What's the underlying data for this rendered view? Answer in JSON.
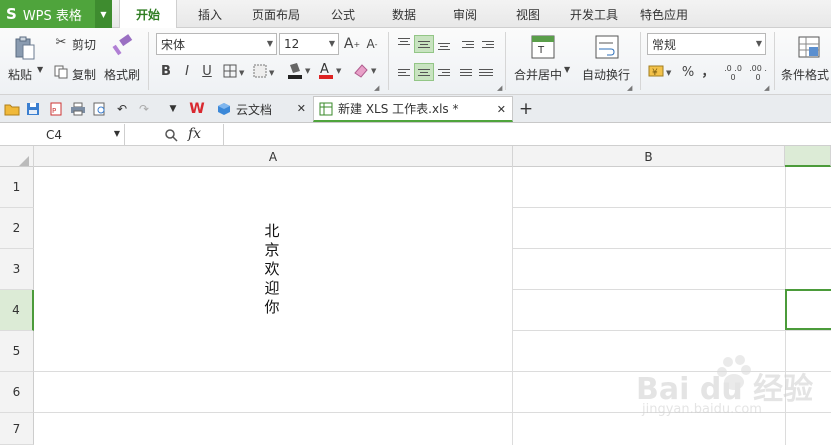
{
  "app": {
    "logo_text": "WPS 表格",
    "logo_glyph": "S"
  },
  "menu_tabs": [
    "开始",
    "插入",
    "页面布局",
    "公式",
    "数据",
    "审阅",
    "视图",
    "开发工具",
    "特色应用"
  ],
  "ribbon": {
    "paste": "粘贴",
    "cut": "剪切",
    "copy": "复制",
    "format_painter": "格式刷",
    "font_name": "宋体",
    "font_size": "12",
    "bold": "B",
    "italic": "I",
    "underline": "U",
    "merge_center": "合并居中",
    "wrap_text": "自动换行",
    "number_format": "常规",
    "percent": "%",
    "comma": "，",
    "dec_inc": ".0 .00",
    "dec_dec": ".00 .0",
    "conditional_format": "条件格式"
  },
  "doc_tabs": [
    {
      "label": "云文档"
    },
    {
      "label": "新建 XLS 工作表.xls *"
    }
  ],
  "formula_bar": {
    "name_box": "C4",
    "fx_label": "fx",
    "formula": ""
  },
  "grid": {
    "columns": [
      "A",
      "B"
    ],
    "rows": [
      "1",
      "2",
      "3",
      "4",
      "5",
      "6",
      "7"
    ],
    "selected_cell": "C4",
    "cell_a1_text": [
      "北",
      "京",
      "欢",
      "迎",
      "你"
    ]
  },
  "watermark": {
    "brand": "Bai du 经验",
    "url": "jingyan.baidu.com"
  },
  "colors": {
    "accent": "#4fa43c",
    "active_tab": "#2f7d22",
    "selection": "#4b9b3a"
  }
}
